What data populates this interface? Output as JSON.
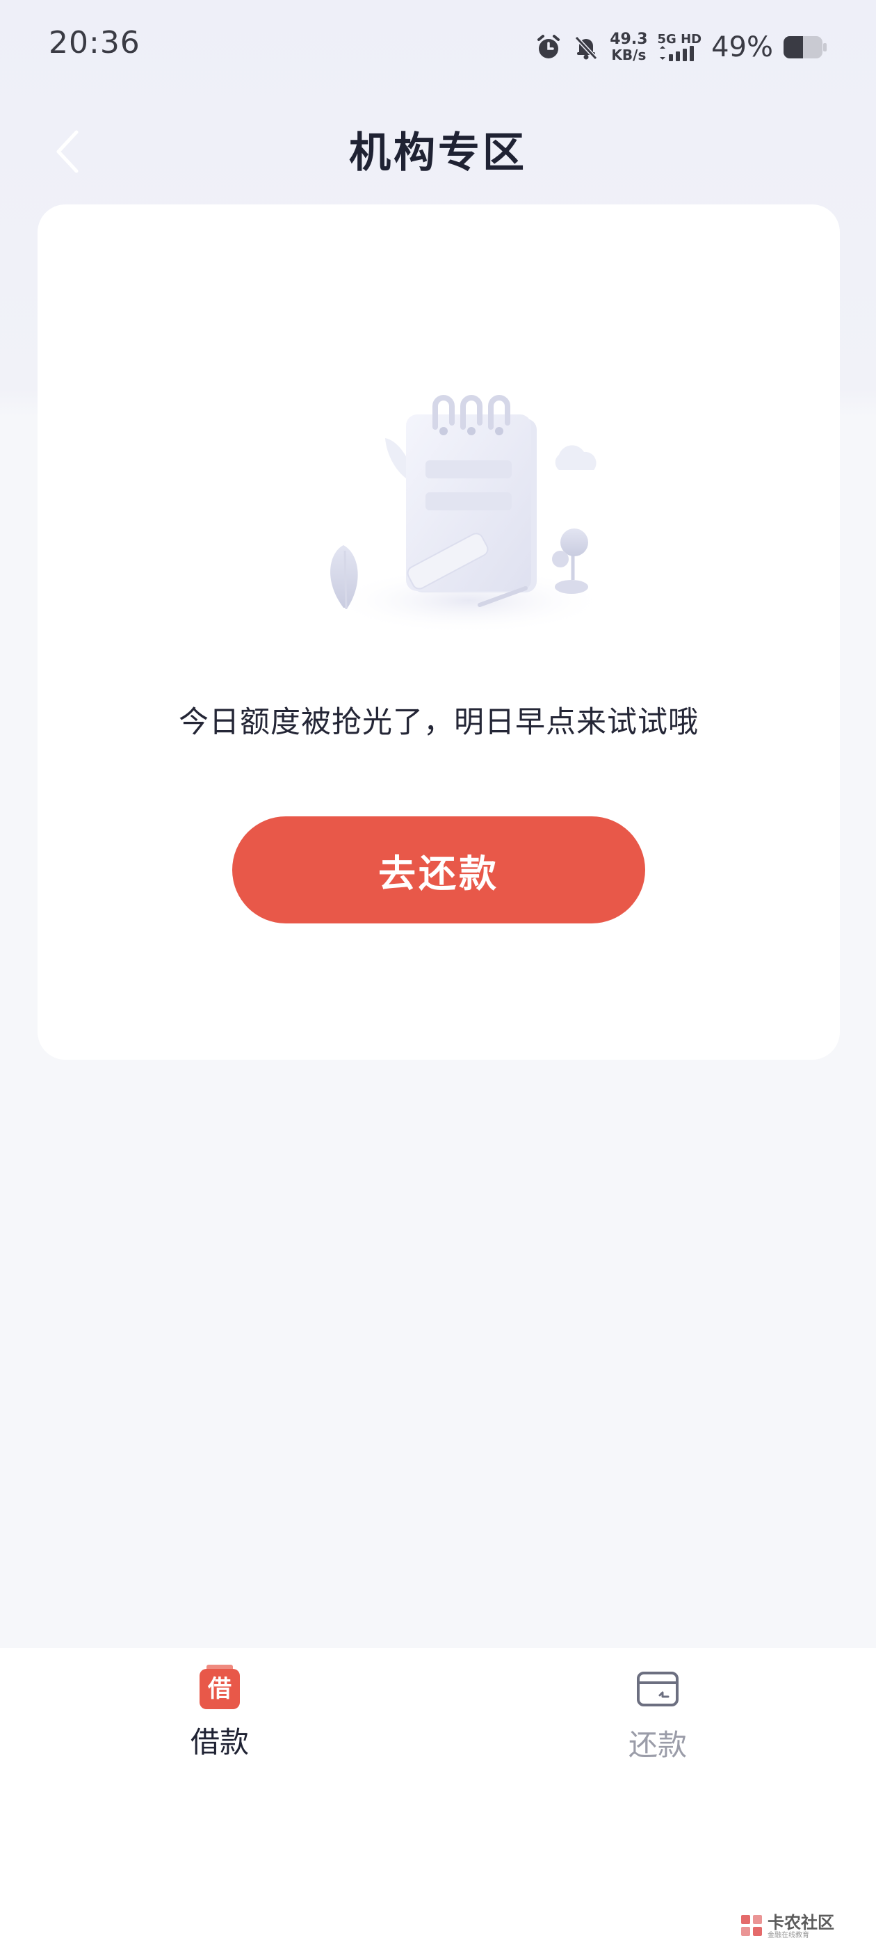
{
  "status_bar": {
    "time": "20:36",
    "net_speed_value": "49.3",
    "net_speed_unit": "KB/s",
    "signal_label": "5G HD",
    "battery_percent": "49%",
    "icons": [
      "alarm-icon",
      "bell-muted-icon",
      "signal-icon",
      "battery-icon"
    ]
  },
  "nav": {
    "back_icon": "chevron-left-icon",
    "title": "机构专区"
  },
  "card": {
    "illustration": "empty-notepad-illustration",
    "message": "今日额度被抢光了，明日早点来试试哦",
    "button_label": "去还款"
  },
  "tabs": [
    {
      "label": "借款",
      "icon_text": "借",
      "active": true
    },
    {
      "label": "还款",
      "icon": "card-icon",
      "active": false
    }
  ],
  "watermark": {
    "title": "卡农社区",
    "subtitle": "金融在线教育"
  },
  "colors": {
    "accent": "#e85849",
    "text_primary": "#1f2233",
    "text_inactive": "#9a9ca8",
    "background": "#f6f7fa",
    "card": "#ffffff"
  }
}
